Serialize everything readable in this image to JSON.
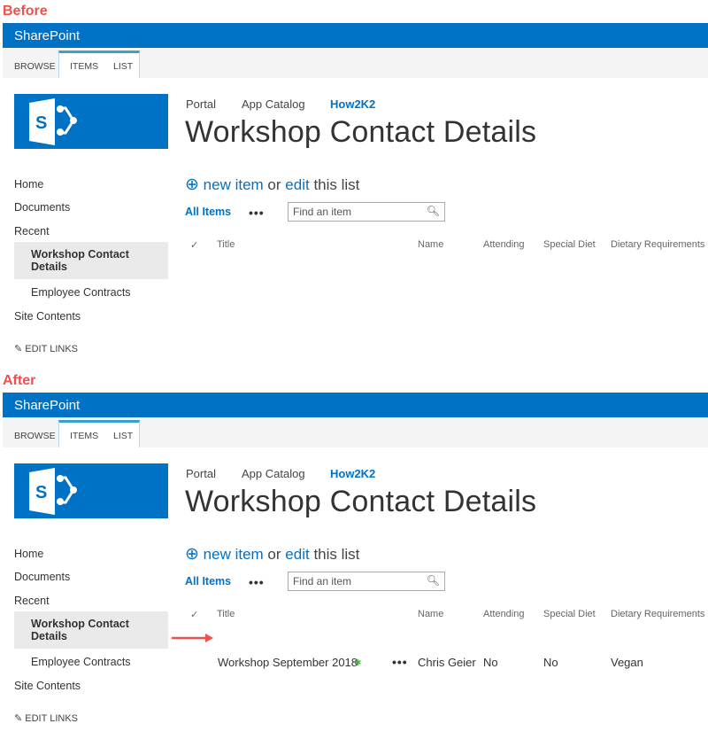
{
  "labels": {
    "before": "Before",
    "after": "After"
  },
  "suite": {
    "title": "SharePoint"
  },
  "ribbon": {
    "tabs": [
      "BROWSE",
      "ITEMS",
      "LIST"
    ]
  },
  "breadcrumbs": [
    "Portal",
    "App Catalog",
    "How2K2"
  ],
  "page_title": "Workshop Contact Details",
  "nav": {
    "home": "Home",
    "documents": "Documents",
    "recent": "Recent",
    "workshop_line1": "Workshop Contact",
    "workshop_line2": "Details",
    "employee": "Employee Contracts",
    "site_contents": "Site Contents",
    "edit_links": "EDIT LINKS"
  },
  "actions": {
    "new_item": "new item",
    "or": "or",
    "edit": "edit",
    "this_list": "this list",
    "all_items": "All Items",
    "more": "•••"
  },
  "search": {
    "placeholder": "Find an item"
  },
  "columns": [
    "Title",
    "Name",
    "Attending",
    "Special Diet",
    "Dietary Requirements"
  ],
  "row": {
    "title": "Workshop September 2018",
    "new_marker": "✱",
    "name": "Chris Geier",
    "attending": "No",
    "special_diet": "No",
    "dietary_requirements": "Vegan"
  },
  "colors": {
    "brand": "#0072c6",
    "annotation": "#f0504f"
  }
}
